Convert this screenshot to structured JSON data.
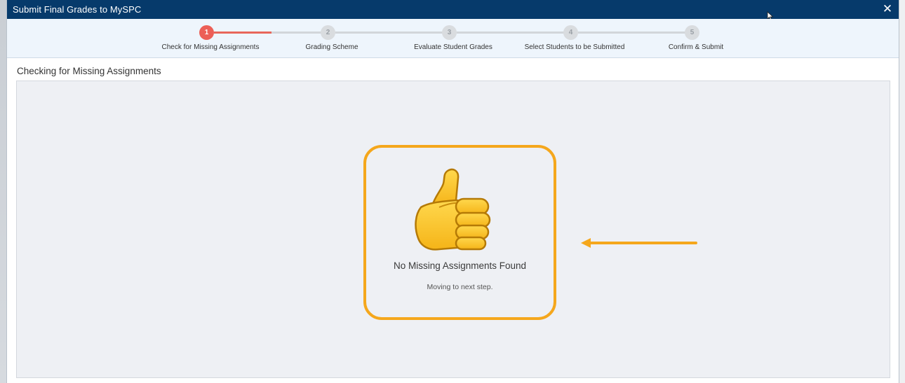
{
  "dialog": {
    "title": "Submit Final Grades to MySPC",
    "close_label": "✕"
  },
  "stepper": {
    "steps": [
      {
        "number": "1",
        "label": "Check for Missing Assignments",
        "active": true
      },
      {
        "number": "2",
        "label": "Grading Scheme",
        "active": false
      },
      {
        "number": "3",
        "label": "Evaluate Student Grades",
        "active": false
      },
      {
        "number": "4",
        "label": "Select Students to be Submitted",
        "active": false
      },
      {
        "number": "5",
        "label": "Confirm & Submit",
        "active": false
      }
    ]
  },
  "section": {
    "title": "Checking for Missing Assignments"
  },
  "result": {
    "icon": "thumbs-up-icon",
    "title": "No Missing Assignments Found",
    "subtitle": "Moving to next step."
  },
  "colors": {
    "titlebar": "#063a6b",
    "active_step": "#ec5f57",
    "highlight": "#f5a71c"
  }
}
